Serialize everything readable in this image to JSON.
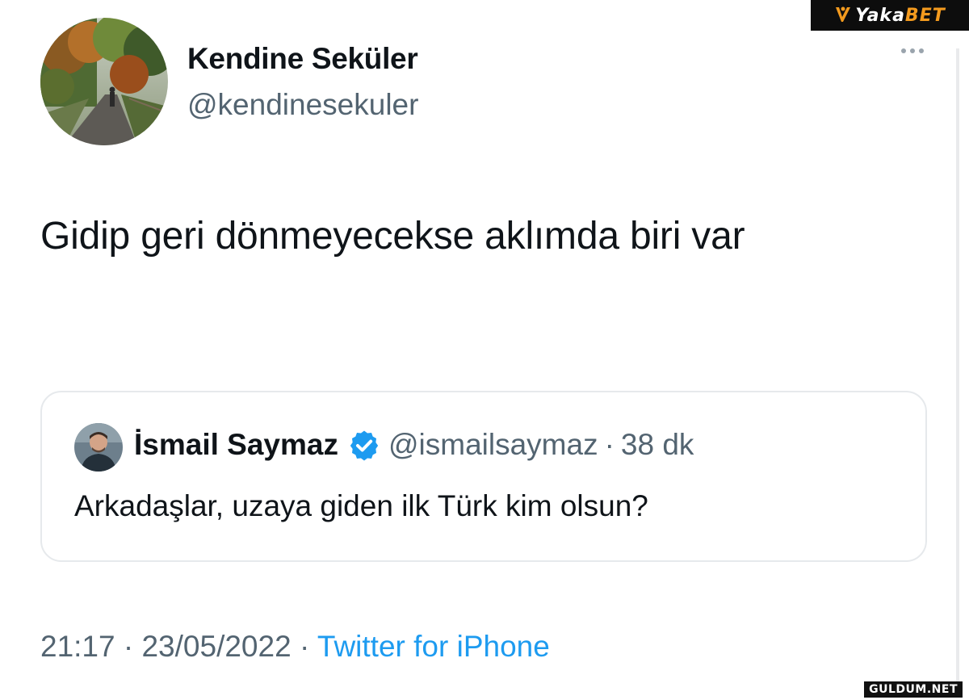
{
  "watermark": {
    "brand_main": "Yaka",
    "brand_accent": "BET",
    "footer_site": "GULDUM.NET"
  },
  "tweet": {
    "display_name": "Kendine Seküler",
    "handle": "@kendinesekuler",
    "text": "Gidip geri dönmeyecekse aklımda biri var",
    "time": "21:17",
    "date": "23/05/2022",
    "source": "Twitter for iPhone",
    "meta_separator": "·"
  },
  "quoted_tweet": {
    "display_name": "İsmail Saymaz",
    "handle": "@ismailsaymaz",
    "separator": "·",
    "time_ago": "38 dk",
    "text": "Arkadaşlar, uzaya giden ilk Türk kim olsun?",
    "verified": true
  },
  "icons": {
    "more": "more-horizontal-icon",
    "verified": "verified-badge-icon"
  },
  "colors": {
    "text_primary": "#0f1419",
    "text_secondary": "#536471",
    "link": "#1d9bf0",
    "verified": "#1d9bf0",
    "brand_accent": "#f39a1e"
  }
}
